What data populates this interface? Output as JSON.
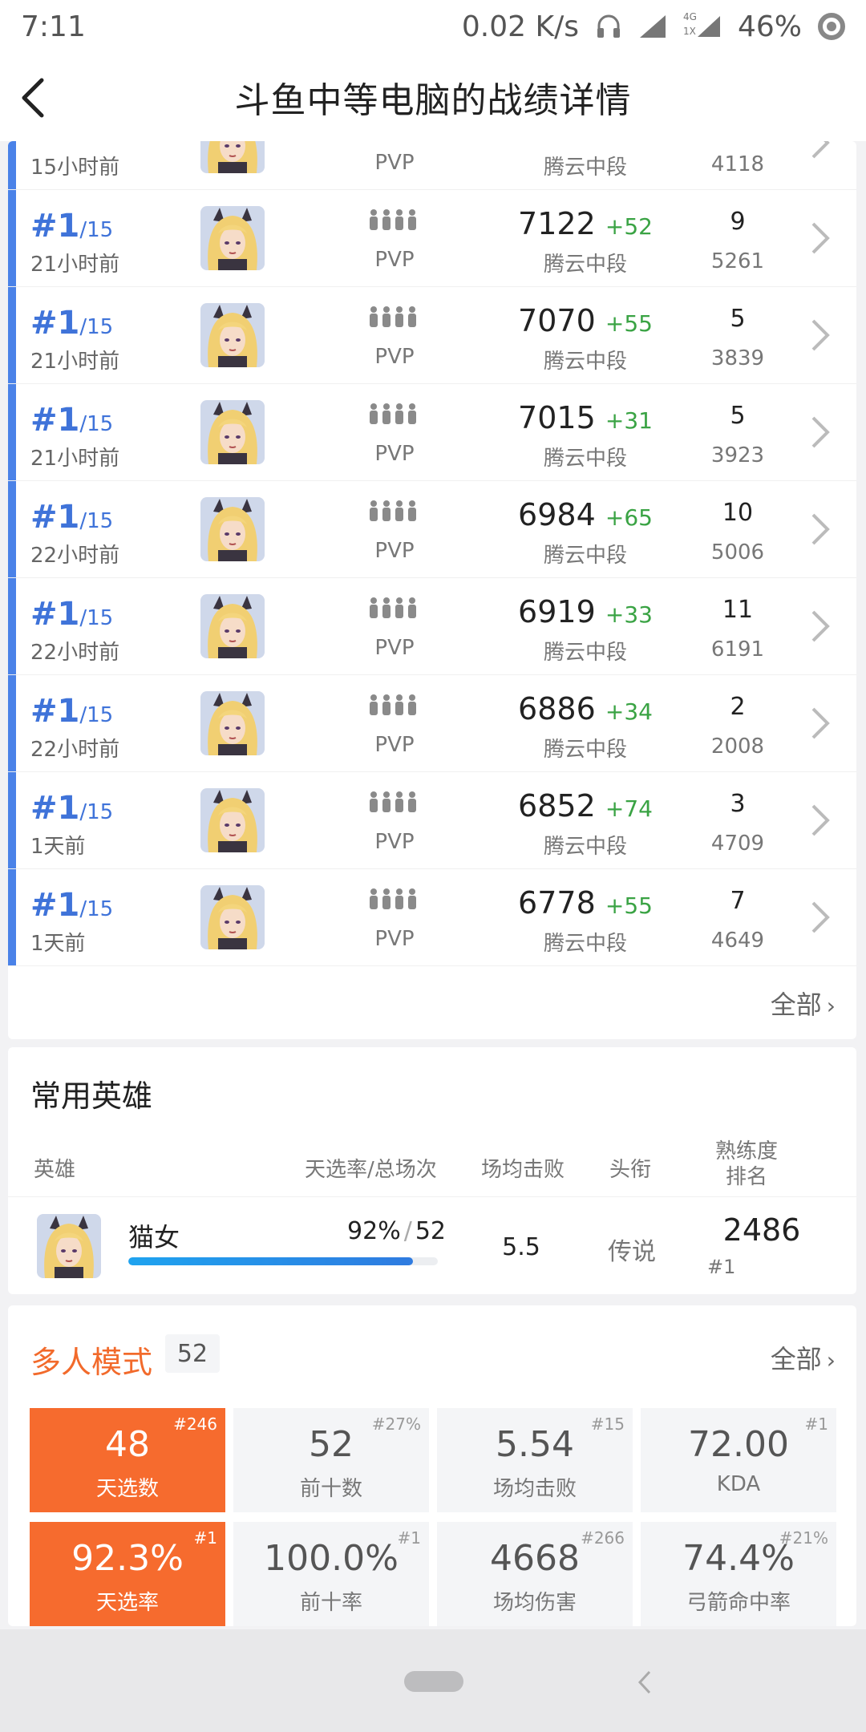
{
  "status_bar": {
    "time": "7:11",
    "net_speed": "0.02 K/s",
    "net_type": "4G",
    "sim_slot": "1X",
    "battery": "46%",
    "icons": [
      "headset-icon",
      "signal-icon",
      "signal-4g-icon",
      "circle-status-icon"
    ]
  },
  "header": {
    "title": "斗鱼中等电脑的战绩详情",
    "back_icon": "back-arrow-icon"
  },
  "matches": {
    "top_partial": {
      "when": "15小时前",
      "mode": "PVP",
      "tier": "腾云中段",
      "num2": "4118"
    },
    "rows": [
      {
        "rank": "#1",
        "total": "/15",
        "when": "21小时前",
        "mode": "PVP",
        "score": "7122",
        "delta": "+52",
        "tier": "腾云中段",
        "kills": "9",
        "num2": "5261"
      },
      {
        "rank": "#1",
        "total": "/15",
        "when": "21小时前",
        "mode": "PVP",
        "score": "7070",
        "delta": "+55",
        "tier": "腾云中段",
        "kills": "5",
        "num2": "3839"
      },
      {
        "rank": "#1",
        "total": "/15",
        "when": "21小时前",
        "mode": "PVP",
        "score": "7015",
        "delta": "+31",
        "tier": "腾云中段",
        "kills": "5",
        "num2": "3923"
      },
      {
        "rank": "#1",
        "total": "/15",
        "when": "22小时前",
        "mode": "PVP",
        "score": "6984",
        "delta": "+65",
        "tier": "腾云中段",
        "kills": "10",
        "num2": "5006"
      },
      {
        "rank": "#1",
        "total": "/15",
        "when": "22小时前",
        "mode": "PVP",
        "score": "6919",
        "delta": "+33",
        "tier": "腾云中段",
        "kills": "11",
        "num2": "6191"
      },
      {
        "rank": "#1",
        "total": "/15",
        "when": "22小时前",
        "mode": "PVP",
        "score": "6886",
        "delta": "+34",
        "tier": "腾云中段",
        "kills": "2",
        "num2": "2008"
      },
      {
        "rank": "#1",
        "total": "/15",
        "when": "1天前",
        "mode": "PVP",
        "score": "6852",
        "delta": "+74",
        "tier": "腾云中段",
        "kills": "3",
        "num2": "4709"
      },
      {
        "rank": "#1",
        "total": "/15",
        "when": "1天前",
        "mode": "PVP",
        "score": "6778",
        "delta": "+55",
        "tier": "腾云中段",
        "kills": "7",
        "num2": "4649"
      }
    ],
    "all_label": "全部",
    "accent": "#4a82e8",
    "delta_color": "#3aa344"
  },
  "heroes": {
    "title": "常用英雄",
    "columns": {
      "hero": "英雄",
      "rate": "天选率/总场次",
      "avg_kills": "场均击败",
      "title": "头衔",
      "proficiency_line1": "熟练度",
      "proficiency_line2": "排名"
    },
    "rows": [
      {
        "name": "猫女",
        "rate": "92%",
        "sep": "/",
        "games": "52",
        "rate_fraction": 0.92,
        "avg_kills": "5.5",
        "title": "传说",
        "proficiency": "2486",
        "rank": "#1"
      }
    ],
    "bar_color": "#1fa3ef"
  },
  "multi": {
    "title": "多人模式",
    "count": "52",
    "all_label": "全部",
    "title_color": "#f26a2b",
    "highlight_color": "#f66b2e",
    "tiles": [
      {
        "value": "48",
        "label": "天选数",
        "rank": "#246",
        "highlight": true
      },
      {
        "value": "52",
        "label": "前十数",
        "rank": "#27%",
        "highlight": false
      },
      {
        "value": "5.54",
        "label": "场均击败",
        "rank": "#15",
        "highlight": false
      },
      {
        "value": "72.00",
        "label": "KDA",
        "rank": "#1",
        "highlight": false
      },
      {
        "value": "92.3%",
        "label": "天选率",
        "rank": "#1",
        "highlight": true
      },
      {
        "value": "100.0%",
        "label": "前十率",
        "rank": "#1",
        "highlight": false
      },
      {
        "value": "4668",
        "label": "场均伤害",
        "rank": "#266",
        "highlight": false
      },
      {
        "value": "74.4%",
        "label": "弓箭命中率",
        "rank": "#21%",
        "highlight": false
      }
    ]
  }
}
